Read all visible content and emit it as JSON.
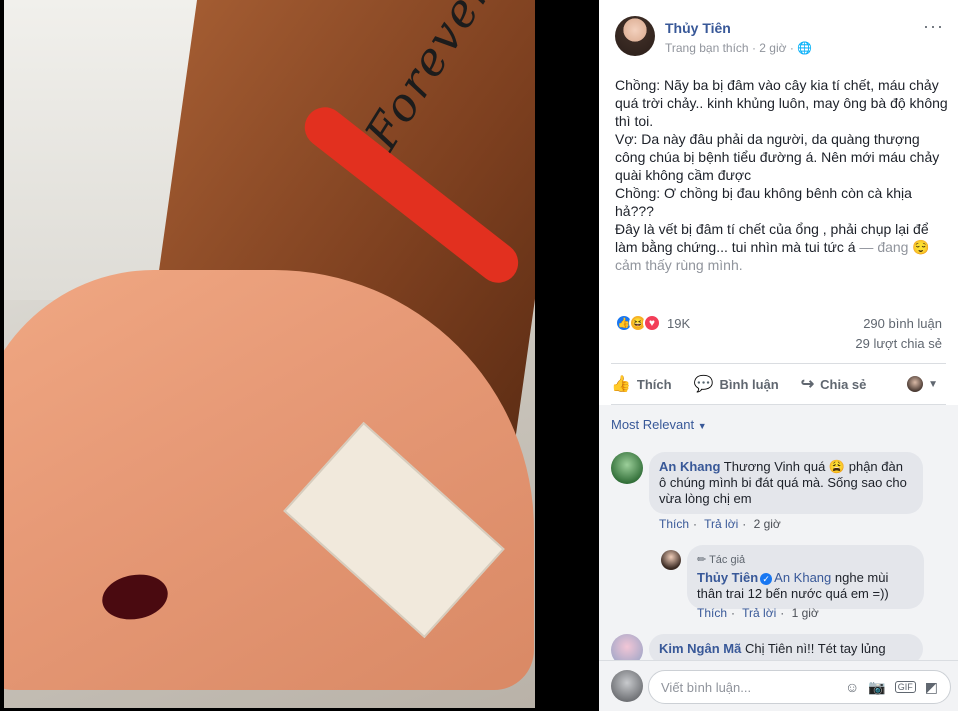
{
  "post": {
    "author": "Thủy Tiên",
    "meta": "Trang bạn thích · 2 giờ · ",
    "audience_icon": "globe-icon",
    "more": "···",
    "lines": [
      "Chồng: Nãy ba bị đâm vào cây kia tí chết, máu chảy quá trời chảy.. kinh khủng luôn, may ông bà độ không thì toi.",
      "Vợ: Da này đâu phải da người, da quàng thượng công chúa bị bệnh tiểu đường á. Nên mới máu chảy quài không cầm được",
      "Chồng: Ơ chồng bị đau không bênh còn cà khịa hả???",
      "Đây là vết bị đâm tí chết của ổng , phải chụp lại để làm bằng chứng... tui nhìn mà tui tức á"
    ],
    "feeling": " — đang 😌 cảm thấy rùng mình.",
    "photo_tattoo": "Forever"
  },
  "stats": {
    "reaction_count": "19K",
    "comments": "290 bình luận",
    "shares": "29 lượt chia sẻ"
  },
  "actions": {
    "like": "Thích",
    "comment": "Bình luận",
    "share": "Chia sẻ",
    "like_icon": "thumbs-up-icon",
    "comment_icon": "comment-icon",
    "share_icon": "share-arrow-icon"
  },
  "comments": {
    "sort_label": "Most Relevant",
    "items": [
      {
        "name": "An Khang",
        "text": " Thương Vinh quá 😩 phận đàn ô chúng mình bi đát quá mà. Sống sao cho vừa lòng chị em",
        "like": "Thích",
        "reply": "Trả lời",
        "time": "2 giờ"
      },
      {
        "tag": "✏ Tác giả",
        "name": "Thủy Tiên",
        "mention": "An Khang",
        "text": " nghe mùi thân trai 12 bến nước quá em =))",
        "like": "Thích",
        "reply": "Trả lời",
        "time": "1 giờ"
      },
      {
        "name": "Kim Ngân Mã",
        "text": " Chị Tiên nì!! Tét tay lủng"
      }
    ]
  },
  "composer": {
    "placeholder": "Viết bình luận..."
  }
}
